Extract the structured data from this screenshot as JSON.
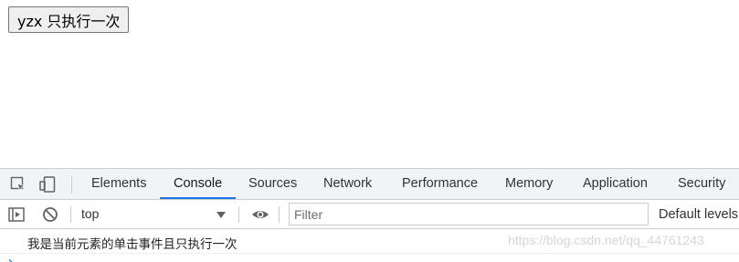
{
  "page": {
    "button_label": "yzx 只执行一次"
  },
  "devtools": {
    "tabs": [
      {
        "label": "Elements"
      },
      {
        "label": "Console",
        "active": true
      },
      {
        "label": "Sources"
      },
      {
        "label": "Network"
      },
      {
        "label": "Performance"
      },
      {
        "label": "Memory"
      },
      {
        "label": "Application"
      },
      {
        "label": "Security"
      }
    ],
    "icons": {
      "inspect": "inspect-element-icon",
      "device": "device-toolbar-icon",
      "sidebar": "show-sidebar-icon",
      "clear": "clear-console-icon",
      "live_expression": "eye-icon",
      "dropdown": "chevron-down-icon",
      "prompt": "prompt-chevron-icon"
    },
    "accent_color": "#1a73e8",
    "console_toolbar": {
      "context": "top",
      "filter_placeholder": "Filter",
      "filter_value": "",
      "levels_label": "Default levels"
    },
    "console": {
      "messages": [
        {
          "text": "我是当前元素的单击事件且只执行一次"
        }
      ],
      "prompt_glyph": "›"
    }
  },
  "watermark": "https://blog.csdn.net/qq_44761243"
}
